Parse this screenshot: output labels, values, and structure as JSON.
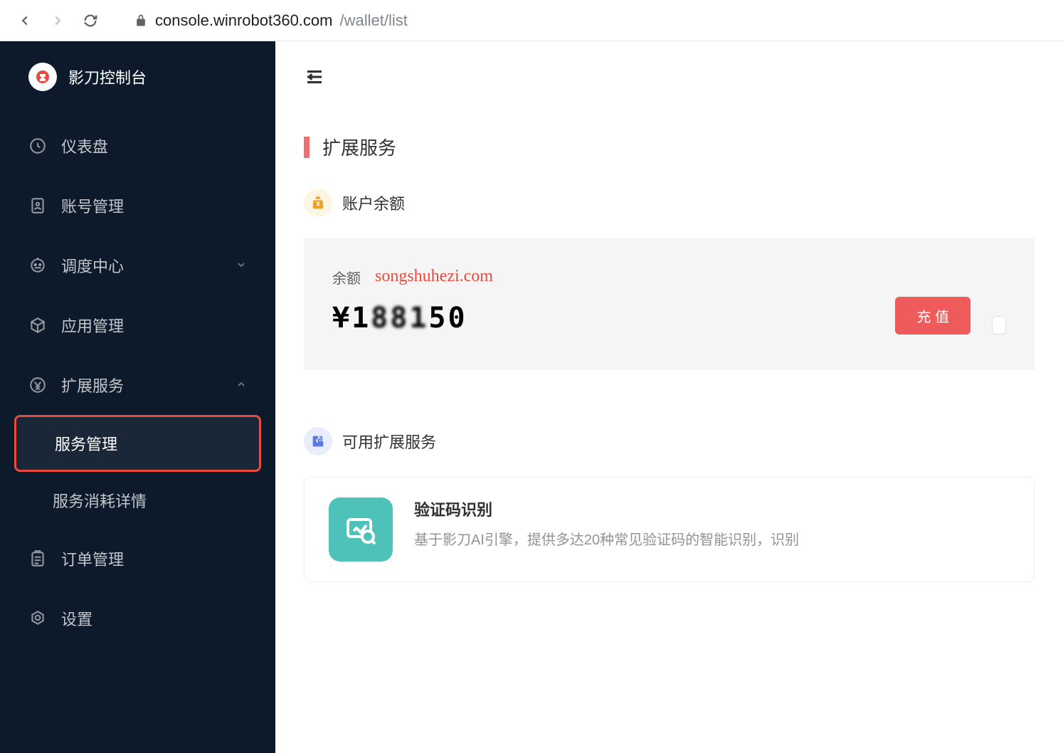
{
  "browser": {
    "url_host": "console.winrobot360.com",
    "url_path": "/wallet/list"
  },
  "sidebar": {
    "brand": "影刀控制台",
    "items": [
      {
        "icon": "dashboard",
        "label": "仪表盘",
        "expandable": false
      },
      {
        "icon": "account",
        "label": "账号管理",
        "expandable": false
      },
      {
        "icon": "robot",
        "label": "调度中心",
        "expandable": true,
        "expanded": false
      },
      {
        "icon": "cube",
        "label": "应用管理",
        "expandable": false
      },
      {
        "icon": "yen",
        "label": "扩展服务",
        "expandable": true,
        "expanded": true,
        "children": [
          {
            "label": "服务管理",
            "active": true
          },
          {
            "label": "服务消耗详情",
            "active": false
          }
        ]
      },
      {
        "icon": "order",
        "label": "订单管理",
        "expandable": false
      },
      {
        "icon": "settings",
        "label": "设置",
        "expandable": false
      }
    ]
  },
  "main": {
    "page_title": "扩展服务",
    "balance_section": {
      "title": "账户余额",
      "balance_label": "余额",
      "balance_value": "¥188150",
      "watermark": "songshuhezi.com",
      "recharge_btn": "充 值"
    },
    "services_section": {
      "title": "可用扩展服务",
      "items": [
        {
          "name": "验证码识别",
          "desc": "基于影刀AI引擎，提供多达20种常见验证码的智能识别，识别"
        }
      ]
    }
  }
}
